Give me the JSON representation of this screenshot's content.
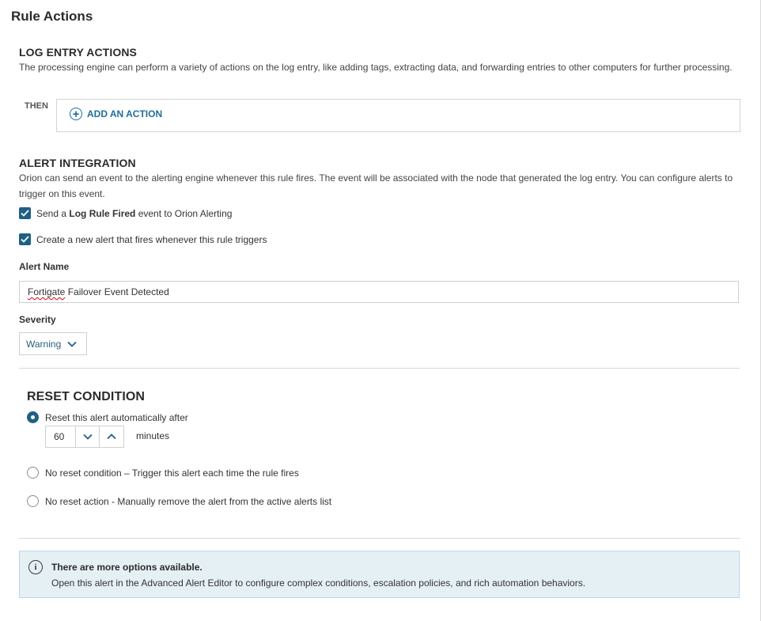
{
  "page": {
    "title": "Rule Actions"
  },
  "log_entry_actions": {
    "heading": "LOG ENTRY ACTIONS",
    "description": "The processing engine can perform a variety of actions on the log entry, like adding tags, extracting data, and forwarding entries to other computers for further processing.",
    "then_label": "THEN",
    "add_action_label": "ADD AN ACTION",
    "add_action_icon": "plus-circle-icon"
  },
  "alert_integration": {
    "heading": "ALERT INTEGRATION",
    "description": "Orion can send an event to the alerting engine whenever this rule fires. The event will be associated with the node that generated the log entry. You can configure alerts to trigger on this event.",
    "send_event": {
      "checked": true,
      "prefix": "Send a ",
      "bold": "Log Rule Fired",
      "suffix": " event to Orion Alerting"
    },
    "create_alert": {
      "checked": true,
      "label": "Create a new alert that fires whenever this rule triggers"
    },
    "alert_name_label": "Alert Name",
    "alert_name_value_word1": "Fortigate",
    "alert_name_value_rest": " Failover Event Detected",
    "severity_label": "Severity",
    "severity_value": "Warning"
  },
  "reset_condition": {
    "heading": "RESET CONDITION",
    "option_auto": {
      "selected": true,
      "label": "Reset this alert automatically after"
    },
    "minutes_value": "60",
    "minutes_label": "minutes",
    "option_none": {
      "selected": false,
      "label": "No reset condition – Trigger this alert each time the rule fires"
    },
    "option_manual": {
      "selected": false,
      "label": "No reset action - Manually remove the alert from the active alerts list"
    }
  },
  "info_banner": {
    "icon": "info-icon",
    "title": "There are more options available.",
    "body": "Open this alert in the Advanced Alert Editor to configure complex conditions, escalation policies, and rich automation behaviors."
  },
  "colors": {
    "accent": "#1f5f86",
    "link": "#1f6e9a",
    "info_bg": "#e5f0f5"
  }
}
